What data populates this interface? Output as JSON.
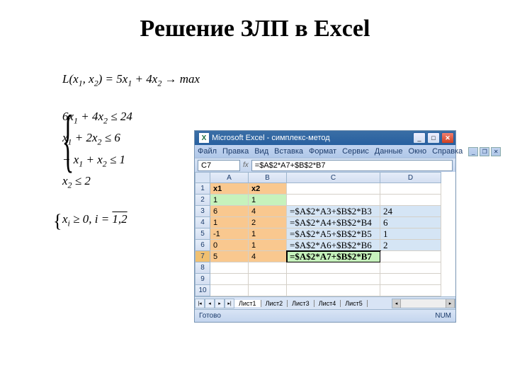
{
  "slide": {
    "title": "Решение ЗЛП в Excel"
  },
  "formulas": {
    "objective": "L(x₁, x₂) = 5x₁ + 4x₂ → max",
    "constraints": [
      "6x₁ + 4x₂ ≤ 24",
      "x₁ + 2x₂ ≤ 6",
      "− x₁ + x₂ ≤ 1",
      "x₂ ≤ 2"
    ],
    "nonneg_text": "xᵢ ≥ 0, i = 1,2",
    "nonneg_over": "1,2"
  },
  "excel": {
    "title": "Microsoft Excel - симплекс-метод",
    "menu": [
      "Файл",
      "Правка",
      "Вид",
      "Вставка",
      "Формат",
      "Сервис",
      "Данные",
      "Окно",
      "Справка"
    ],
    "namebox": "С7",
    "formula": "=$A$2*A7+$B$2*B7",
    "columns": [
      "A",
      "B",
      "C",
      "D"
    ],
    "rows": [
      {
        "n": "1",
        "cells": [
          {
            "v": "x1",
            "cls": "bold orange"
          },
          {
            "v": "x2",
            "cls": "bold orange"
          },
          {
            "v": "",
            "cls": ""
          },
          {
            "v": "",
            "cls": ""
          }
        ]
      },
      {
        "n": "2",
        "cells": [
          {
            "v": "1",
            "cls": "green"
          },
          {
            "v": "1",
            "cls": "green"
          },
          {
            "v": "",
            "cls": ""
          },
          {
            "v": "",
            "cls": ""
          }
        ]
      },
      {
        "n": "3",
        "cells": [
          {
            "v": "6",
            "cls": "orange"
          },
          {
            "v": "4",
            "cls": "orange"
          },
          {
            "v": "=$A$2*A3+$B$2*B3",
            "cls": "ltblue formula-cell"
          },
          {
            "v": "24",
            "cls": "ltblue res"
          }
        ]
      },
      {
        "n": "4",
        "cells": [
          {
            "v": "1",
            "cls": "orange"
          },
          {
            "v": "2",
            "cls": "orange"
          },
          {
            "v": "=$A$2*A4+$B$2*B4",
            "cls": "ltblue formula-cell"
          },
          {
            "v": "6",
            "cls": "ltblue res"
          }
        ]
      },
      {
        "n": "5",
        "cells": [
          {
            "v": "-1",
            "cls": "orange"
          },
          {
            "v": "1",
            "cls": "orange"
          },
          {
            "v": "=$A$2*A5+$B$2*B5",
            "cls": "ltblue formula-cell"
          },
          {
            "v": "1",
            "cls": "ltblue res"
          }
        ]
      },
      {
        "n": "6",
        "cells": [
          {
            "v": "0",
            "cls": "orange"
          },
          {
            "v": "1",
            "cls": "orange"
          },
          {
            "v": "=$A$2*A6+$B$2*B6",
            "cls": "ltblue formula-cell"
          },
          {
            "v": "2",
            "cls": "ltblue res"
          }
        ]
      },
      {
        "n": "7",
        "sel": true,
        "cells": [
          {
            "v": "5",
            "cls": "orange"
          },
          {
            "v": "4",
            "cls": "orange"
          },
          {
            "v": "=$A$2*A7+$B$2*B7",
            "cls": "green formula-cell bold sel-cell"
          },
          {
            "v": "",
            "cls": ""
          }
        ]
      },
      {
        "n": "8",
        "cells": [
          {
            "v": "",
            "cls": ""
          },
          {
            "v": "",
            "cls": ""
          },
          {
            "v": "",
            "cls": ""
          },
          {
            "v": "",
            "cls": ""
          }
        ]
      },
      {
        "n": "9",
        "cells": [
          {
            "v": "",
            "cls": ""
          },
          {
            "v": "",
            "cls": ""
          },
          {
            "v": "",
            "cls": ""
          },
          {
            "v": "",
            "cls": ""
          }
        ]
      },
      {
        "n": "10",
        "cells": [
          {
            "v": "",
            "cls": ""
          },
          {
            "v": "",
            "cls": ""
          },
          {
            "v": "",
            "cls": ""
          },
          {
            "v": "",
            "cls": ""
          }
        ]
      }
    ],
    "tabs": [
      "Лист1",
      "Лист2",
      "Лист3",
      "Лист4",
      "Лист5"
    ],
    "status_ready": "Готово",
    "status_num": "NUM"
  }
}
